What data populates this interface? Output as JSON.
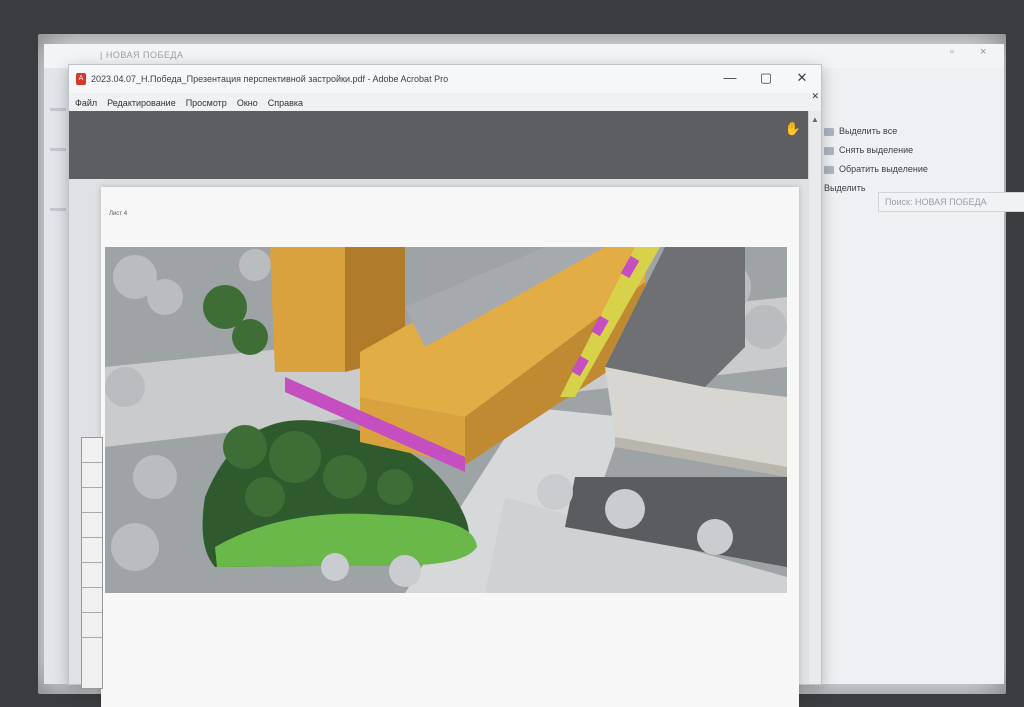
{
  "explorer": {
    "title": "| НОВАЯ ПОБЕДА",
    "menu": [
      "Выделить все",
      "Снять выделение",
      "Обратить выделение",
      "Выделить"
    ],
    "search_placeholder": "Поиск: НОВАЯ ПОБЕДА"
  },
  "acrobat": {
    "title": "2023.04.07_Н.Победа_Презентация перспективной застройки.pdf - Adobe Acrobat Pro",
    "menu": [
      "Файл",
      "Редактирование",
      "Просмотр",
      "Окно",
      "Справка"
    ],
    "page_label": "Лист 4"
  },
  "icons": [
    "minimize-icon",
    "maximize-icon",
    "close-icon",
    "hand-tool-icon",
    "search-icon",
    "pdf-file-icon"
  ],
  "colors": {
    "toolbar": "#5c5e62",
    "pdf_icon": "#d23a2a",
    "building": "#d9a23e",
    "facade_accent": "#c54fc0",
    "lawn": "#6ab84a"
  }
}
